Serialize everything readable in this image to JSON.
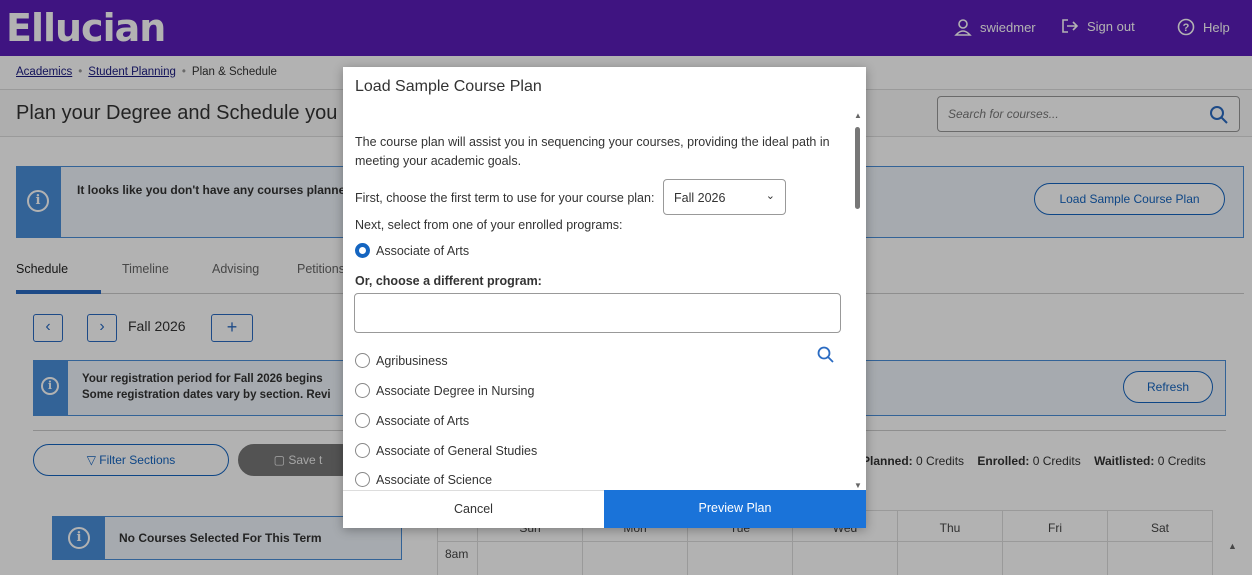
{
  "topbar": {
    "logo": "Ellucian",
    "user": "swiedmer",
    "sign_out": "Sign out",
    "help": "Help"
  },
  "breadcrumb": [
    "Academics",
    "Student Planning",
    "Plan & Schedule"
  ],
  "page_title": "Plan your Degree and Schedule you",
  "search": {
    "placeholder": "Search for courses..."
  },
  "alert_no_courses": {
    "text": "It looks like you don't have any courses planne",
    "button": "Load Sample Course Plan"
  },
  "tabs": [
    "Schedule",
    "Timeline",
    "Advising",
    "Petitions"
  ],
  "term_nav": {
    "term": "Fall 2026",
    "add": "+"
  },
  "alert_registration": {
    "line1": "Your registration period for Fall 2026 begins",
    "line2": "Some registration dates vary by section. Revi",
    "button": "Refresh"
  },
  "actions": {
    "filter": "Filter Sections",
    "save": "Save t"
  },
  "credits": {
    "planned_label": "Planned:",
    "planned_value": "0 Credits",
    "enrolled_label": "Enrolled:",
    "enrolled_value": "0 Credits",
    "waitlisted_label": "Waitlisted:",
    "waitlisted_value": "0 Credits"
  },
  "no_courses": "No Courses Selected For This Term",
  "calendar": {
    "days": [
      "Sun",
      "Mon",
      "Tue",
      "Wed",
      "Thu",
      "Fri",
      "Sat"
    ],
    "first_time": "8am"
  },
  "modal": {
    "title": "Load Sample Course Plan",
    "description": "The course plan will assist you in sequencing your courses, providing the ideal path in meeting your academic goals.",
    "first_term_label": "First, choose the first term to use for your course plan:",
    "first_term_value": "Fall 2026",
    "enrolled_label": "Next, select from one of your enrolled programs:",
    "enrolled_program": "Associate of Arts",
    "different_label": "Or, choose a different program:",
    "program_input_value": "",
    "programs": [
      "Agribusiness",
      "Associate Degree in Nursing",
      "Associate of Arts",
      "Associate of General Studies",
      "Associate of Science"
    ],
    "cancel": "Cancel",
    "preview": "Preview Plan"
  },
  "colors": {
    "brand": "#5b1eb9",
    "accent": "#1a73d9",
    "info": "#4a8fd8"
  }
}
